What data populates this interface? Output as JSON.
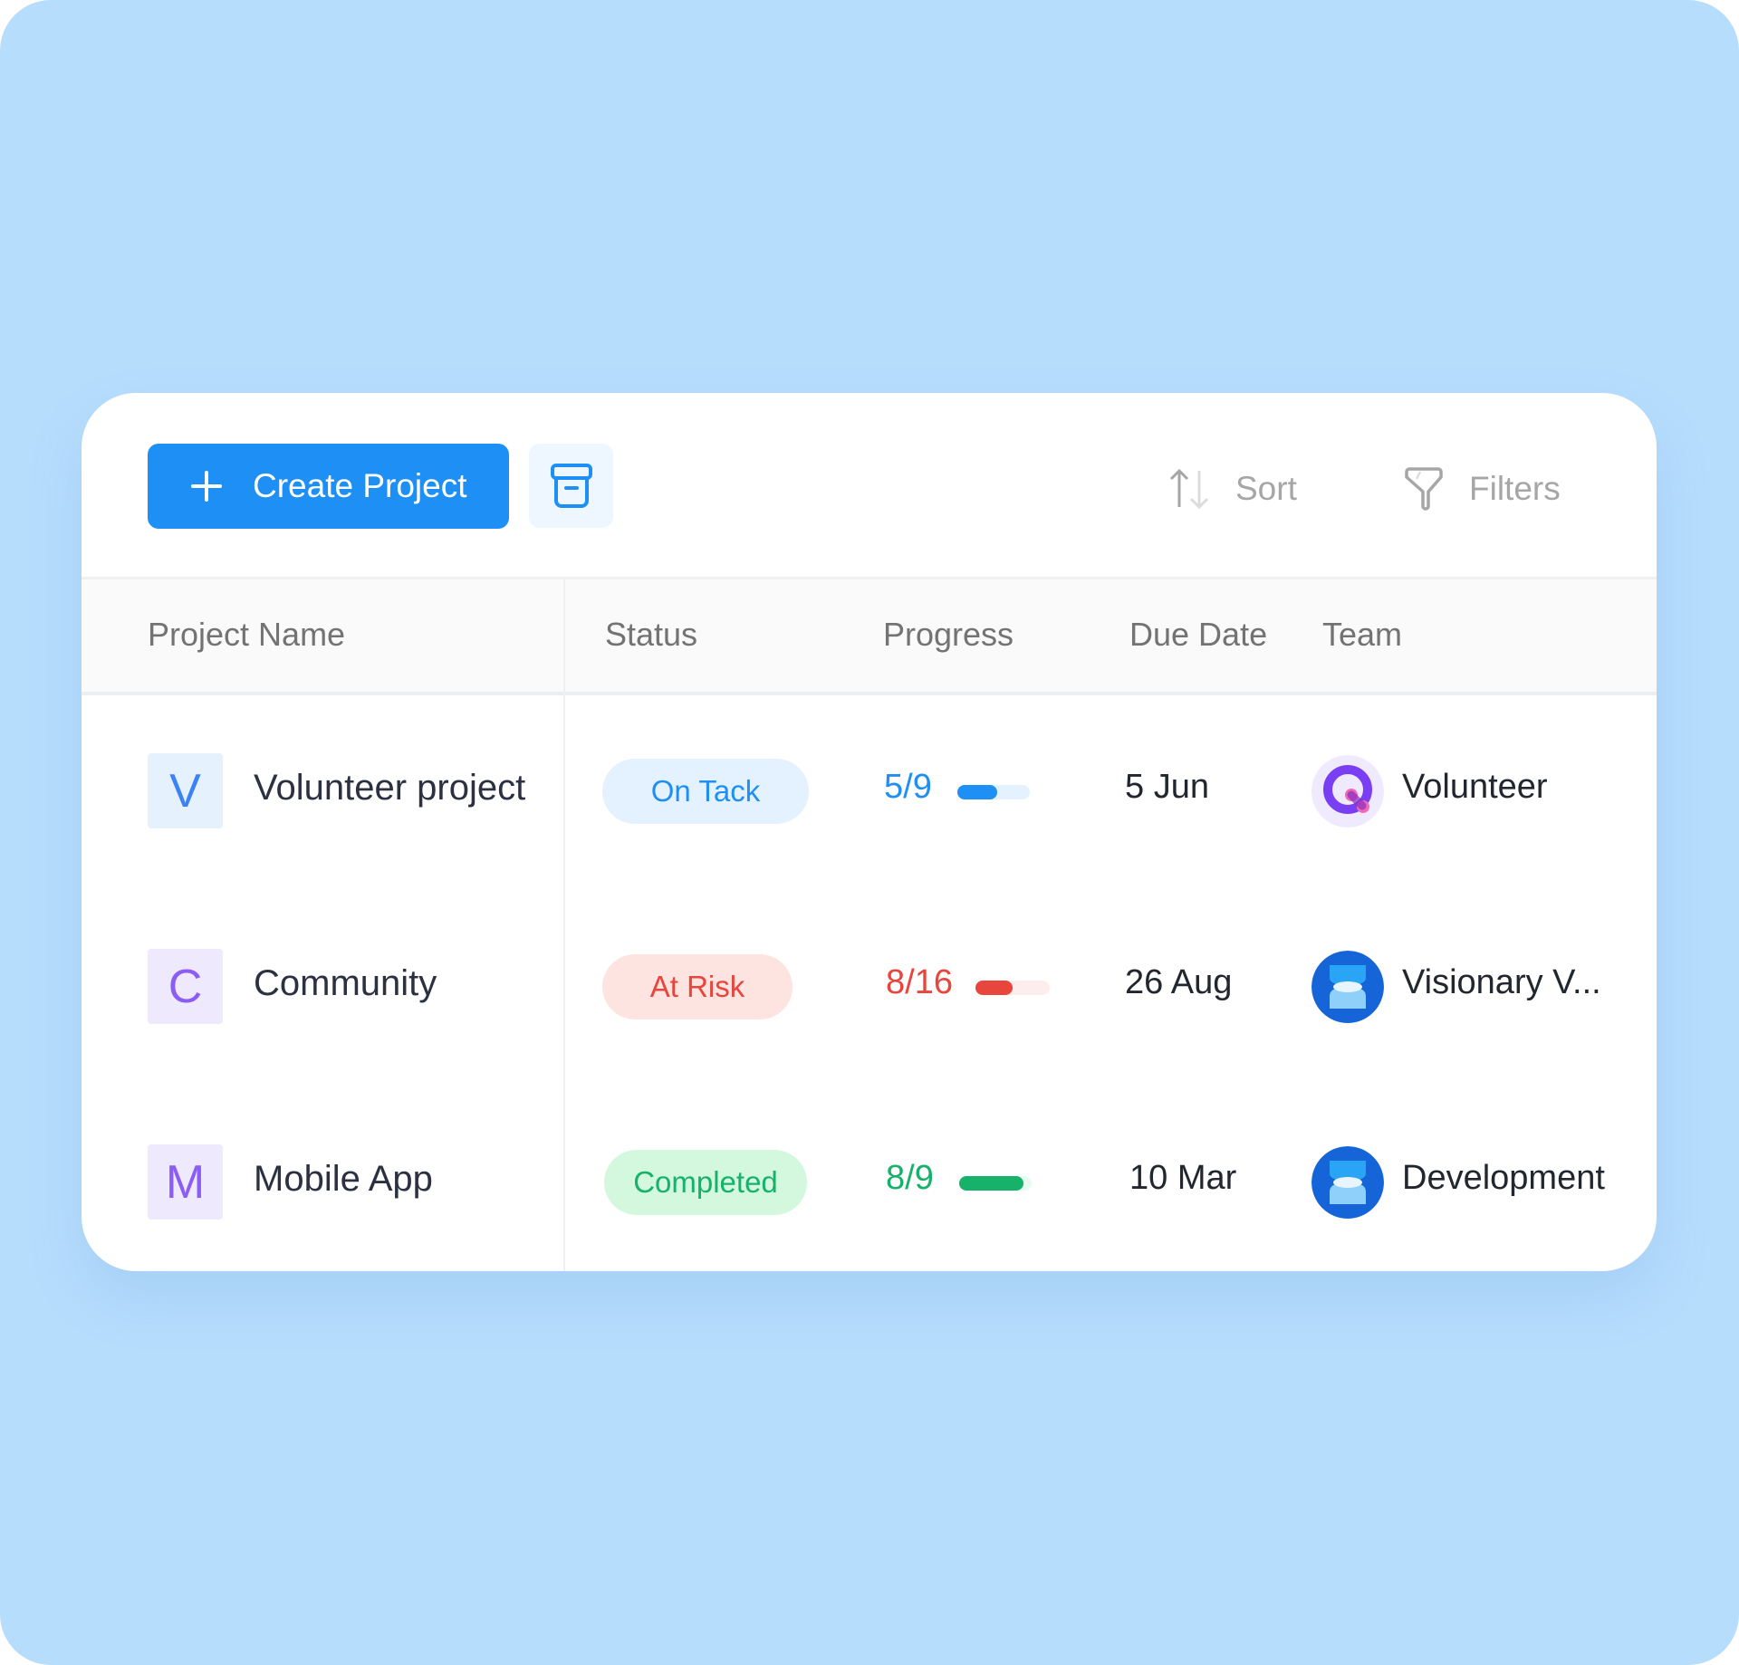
{
  "toolbar": {
    "create_label": "Create Project",
    "create_icon": "plus-icon",
    "archive_icon": "archive-box-icon",
    "sort_label": "Sort",
    "sort_icon": "sort-arrows-icon",
    "filters_label": "Filters",
    "filters_icon": "funnel-icon"
  },
  "colors": {
    "background": "#b7ddfd",
    "primary": "#1e90f5",
    "on_track": "#1e90f5",
    "at_risk": "#e8453c",
    "completed": "#17b26a"
  },
  "table": {
    "columns": [
      "Project Name",
      "Status",
      "Progress",
      "Due Date",
      "Team"
    ],
    "rows": [
      {
        "letter": "V",
        "name": "Volunteer project",
        "status": "On Tack",
        "progress_text": "5/9",
        "progress_done": 5,
        "progress_total": 9,
        "due": "5 Jun",
        "team": "Volunteer",
        "team_icon": "q-logo-icon"
      },
      {
        "letter": "C",
        "name": "Community",
        "status": "At Risk",
        "progress_text": "8/16",
        "progress_done": 8,
        "progress_total": 16,
        "due": "26 Aug",
        "team": "Visionary V...",
        "team_icon": "hourglass-logo-icon"
      },
      {
        "letter": "M",
        "name": "Mobile App",
        "status": "Completed",
        "progress_text": "8/9",
        "progress_done": 8,
        "progress_total": 9,
        "due": "10 Mar",
        "team": "Development",
        "team_icon": "hourglass-logo-icon"
      }
    ]
  }
}
